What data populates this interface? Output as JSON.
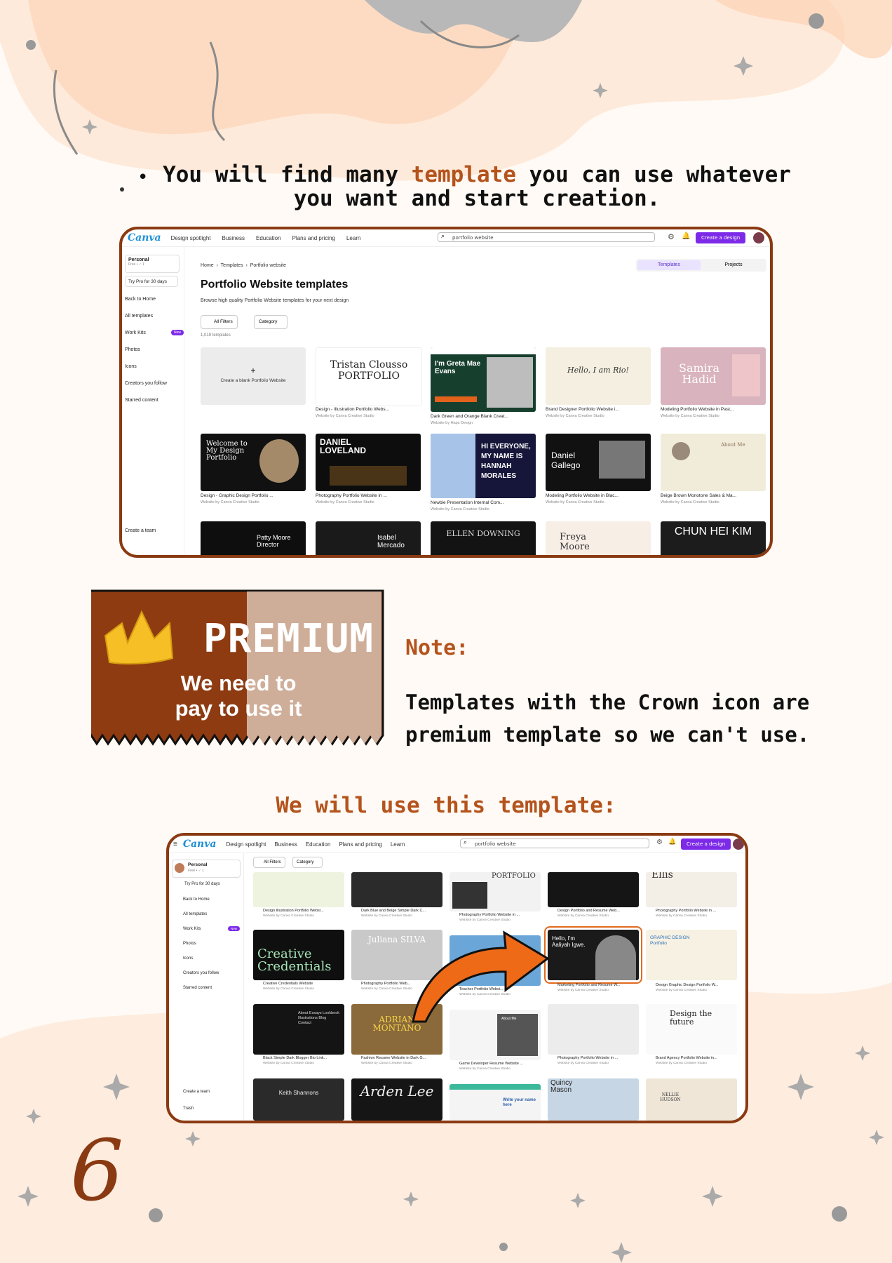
{
  "colors": {
    "accent": "#b4531c",
    "frame": "#8a3a12",
    "canva_purple": "#7d2ae8",
    "premium_dark": "#8e3b12",
    "premium_light": "#cfae99"
  },
  "intro": {
    "bullet": "•",
    "line1_part1": "You will find  many ",
    "line1_accent": "template",
    "line1_part2": " you can use whatever",
    "line2": "you want and start creation."
  },
  "shot1": {
    "logo": "Canva",
    "nav": [
      "Design spotlight",
      "Business",
      "Education",
      "Plans and pricing",
      "Learn"
    ],
    "search": "portfolio website",
    "create_label": "Create a design",
    "sidebar": {
      "account": "Personal",
      "account_sub": "Free • ♂ 1",
      "try_pro": "Try Pro for 30 days",
      "items": [
        "Back to Home",
        "All templates",
        "Work Kits",
        "Photos",
        "Icons",
        "Creators you follow",
        "Starred content"
      ],
      "new_badge": "New",
      "create_team": "Create a team"
    },
    "breadcrumb": [
      "Home",
      "Templates",
      "Portfolio website"
    ],
    "tabs": [
      "Templates",
      "Projects"
    ],
    "title": "Portfolio Website templates",
    "subtitle": "Browse high quality Portfolio Website templates for your next design",
    "filters": [
      "All Filters",
      "Category"
    ],
    "count": "1,019 templates",
    "blank": "Create a blank Portfolio Website",
    "row1": [
      {
        "name": "Design - Illustration Portfolio Webs...",
        "by": "Website by Canva Creative Studio",
        "text": "Tristan Clousso PORTFOLIO"
      },
      {
        "name": "Dark Green and Orange Blank Creat...",
        "by": "Website by Haps Design",
        "text": "I'm Greta Mae Evans"
      },
      {
        "name": "Brand Designer Portfolio Website i...",
        "by": "Website by Canva Creative Studio",
        "text": "Hello, I am Rio!"
      },
      {
        "name": "Modeling Portfolio Website in Past...",
        "by": "Website by Canva Creative Studio",
        "text": "Samira Hadid"
      }
    ],
    "row2": [
      {
        "name": "Design - Graphic Design Portfolio ...",
        "by": "Website by Canva Creative Studio",
        "text": "Welcome to My Design Portfolio"
      },
      {
        "name": "Photography Portfolio Website in ...",
        "by": "Website by Canva Creative Studio",
        "text": "DANIEL LOVELAND"
      },
      {
        "name": "Newbie Presentation Internal Com...",
        "by": "Website by Canva Creative Studio",
        "text": "HI EVERYONE, MY NAME IS HANNAH MORALES"
      },
      {
        "name": "Modeling Portfolio Website in Blac...",
        "by": "Website by Canva Creative Studio",
        "text": "Daniel Gallego"
      },
      {
        "name": "Beige Brown Monotone Sales & Ma...",
        "by": "Website by Canva Creative Studio",
        "text": "About Me"
      }
    ],
    "row3": [
      "Patty Moore Director",
      "Isabel Mercado",
      "ELLEN DOWNING",
      "Freya Moore",
      "CHUN HEI KIM"
    ]
  },
  "premium": {
    "title": "PREMIUM",
    "subtitle": "We need to pay to use it"
  },
  "note": {
    "title": "Note:",
    "body": "Templates with the Crown icon are premium template so we can't use."
  },
  "use_title": "We will use this template:",
  "shot2": {
    "logo": "Canva",
    "nav": [
      "Design spotlight",
      "Business",
      "Education",
      "Plans and pricing",
      "Learn"
    ],
    "search": "portfolio website",
    "create_label": "Create a design",
    "sidebar": {
      "account": "Personal",
      "account_sub": "Free • ♂ 1",
      "try_pro": "Try Pro for 30 days",
      "items": [
        "Back to Home",
        "All templates",
        "Work Kits",
        "Photos",
        "Icons",
        "Creators you follow",
        "Starred content"
      ],
      "new_badge": "New",
      "create_team": "Create a team",
      "trash": "Trash"
    },
    "filters": [
      "All Filters",
      "Category"
    ],
    "row1": [
      {
        "name": "Design Illustration Portfolio Websi...",
        "by": "Website by Canva Creative Studio"
      },
      {
        "name": "Dark Blue and Beige Simple Dark C...",
        "by": "Website by Canva Creative Studio"
      },
      {
        "name": "Photography Portfolio Website in ...",
        "by": "Website by Canva Creative Studio",
        "text": "PORTFOLIO"
      },
      {
        "name": "Design Portfolio and Resume Web...",
        "by": "Website by Canva Creative Studio"
      },
      {
        "name": "Photography Portfolio Website in ...",
        "by": "Website by Canva Creative Studio",
        "text": "Ellis"
      }
    ],
    "row2": [
      {
        "name": "Creative Credentials Website",
        "by": "Website by Canva Creative Studio",
        "text": "Creative Credentials"
      },
      {
        "name": "Photography Portfolio Web...",
        "by": "Website by Canva Creative Studio",
        "text": "Juliana SILVA"
      },
      {
        "name": "Teacher Portfolio Websi...",
        "by": "Website by Canva Creative Studio"
      },
      {
        "name": "Marketing Portfolio and Resume W...",
        "by": "Website by Canva Creative Studio",
        "text": "Hello, I'm Aaliyah Igwe."
      },
      {
        "name": "Design Graphic Design Portfolio W...",
        "by": "Website by Canva Creative Studio",
        "text": "GRAPHIC DESIGN Portfolio"
      }
    ],
    "row3": [
      {
        "name": "Black Simple Dark Blogger Bio Link...",
        "by": "Website by Canva Creative Studio",
        "text": "About Essays Lookbook Illustrations Blog Contact"
      },
      {
        "name": "Fashion Resume Website in Dark G...",
        "by": "Website by Canva Creative Studio",
        "text": "ADRIAN MONTANO"
      },
      {
        "name": "Game Developer Resume Website ...",
        "by": "Website by Canva Creative Studio",
        "text": "About Me"
      },
      {
        "name": "Photography Portfolio Website in ...",
        "by": "Website by Canva Creative Studio"
      },
      {
        "name": "Brand Agency Portfolio Website in...",
        "by": "Website by Canva Creative Studio",
        "text": "Design the future"
      }
    ],
    "row4": [
      "Keith Shannons",
      "Arden Lee",
      "Write your name here",
      "Quincy Mason",
      "NELLIE HUDSON"
    ]
  },
  "page_number": "6"
}
